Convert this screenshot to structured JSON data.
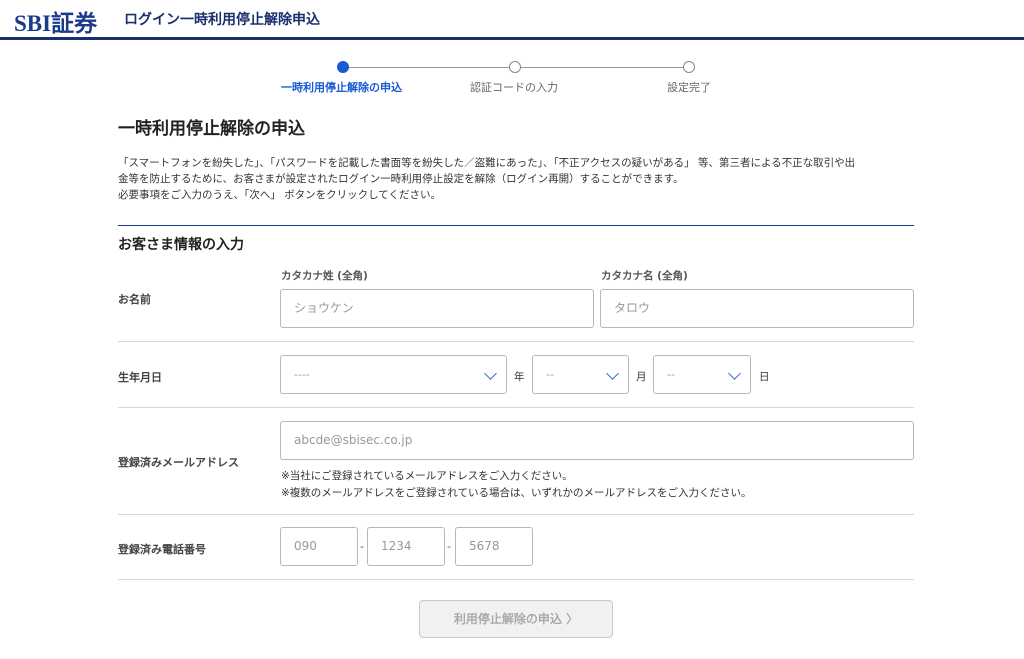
{
  "header": {
    "logo": "SBI証券",
    "title": "ログイン一時利用停止解除申込"
  },
  "steps": [
    {
      "label": "一時利用停止解除の申込",
      "active": true
    },
    {
      "label": "認証コードの入力",
      "active": false
    },
    {
      "label": "設定完了",
      "active": false
    }
  ],
  "page": {
    "title": "一時利用停止解除の申込",
    "description": [
      "「スマートフォンを紛失した」、「パスワードを記載した書面等を紛失した／盗難にあった」、「不正アクセスの疑いがある」 等、第三者による不正な取引や出",
      "金等を防止するために、お客さまが設定されたログイン一時利用停止設定を解除（ログイン再開）することができます。",
      "必要事項をご入力のうえ、「次へ」 ボタンをクリックしてください。"
    ]
  },
  "form": {
    "section_title": "お客さま情報の入力",
    "name": {
      "label": "お名前",
      "last_label": "カタカナ姓 (全角)",
      "last_placeholder": "ショウケン",
      "first_label": "カタカナ名 (全角)",
      "first_placeholder": "タロウ"
    },
    "birth": {
      "label": "生年月日",
      "year_value": "----",
      "year_unit": "年",
      "month_value": "--",
      "month_unit": "月",
      "day_value": "--",
      "day_unit": "日"
    },
    "email": {
      "label": "登録済みメールアドレス",
      "placeholder": "abcde@sbisec.co.jp",
      "notes": [
        "※当社にご登録されているメールアドレスをご入力ください。",
        "※複数のメールアドレスをご登録されている場合は、いずれかのメールアドレスをご入力ください。"
      ]
    },
    "phone": {
      "label": "登録済み電話番号",
      "part1_placeholder": "090",
      "part2_placeholder": "1234",
      "part3_placeholder": "5678",
      "separator": "-"
    },
    "submit_label": "利用停止解除の申込 〉"
  },
  "colors": {
    "brand": "#1a3a8c",
    "accent": "#1a5ad6",
    "disabled": "#aaaaaa"
  }
}
